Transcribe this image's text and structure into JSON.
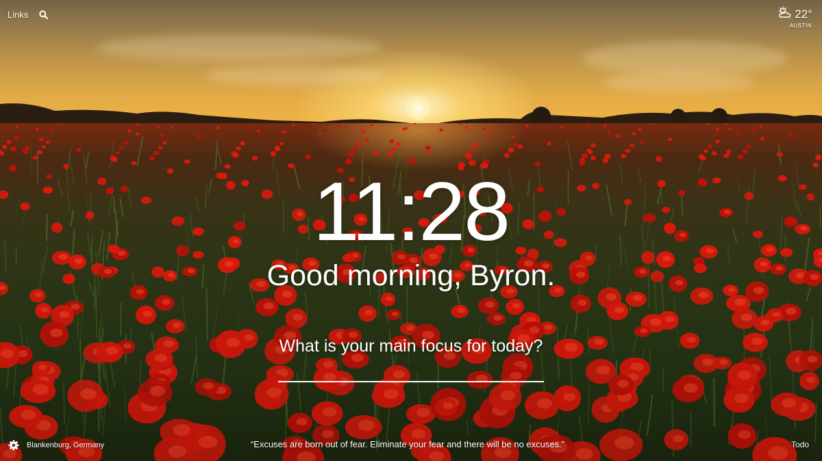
{
  "topbar": {
    "links_label": "Links",
    "search_icon": "search-icon"
  },
  "weather": {
    "icon": "partly-cloudy-icon",
    "temperature": "22°",
    "location": "AUSTIN"
  },
  "clock": {
    "time": "11:28"
  },
  "greeting": {
    "text": "Good morning, Byron."
  },
  "focus": {
    "prompt": "What is your main focus for today?",
    "value": "",
    "placeholder": ""
  },
  "footer": {
    "settings_icon": "gear-icon",
    "photo_location": "Blankenburg, Germany",
    "quote": "“Excuses are born out of fear. Eliminate your fear and there will be no excuses.”",
    "todo_label": "Todo"
  },
  "colors": {
    "text": "#ffffff",
    "sky_top": "#7e6a4c",
    "sky_bottom": "#f2b340",
    "poppy": "#e01a0c",
    "foliage": "#2c3816"
  }
}
